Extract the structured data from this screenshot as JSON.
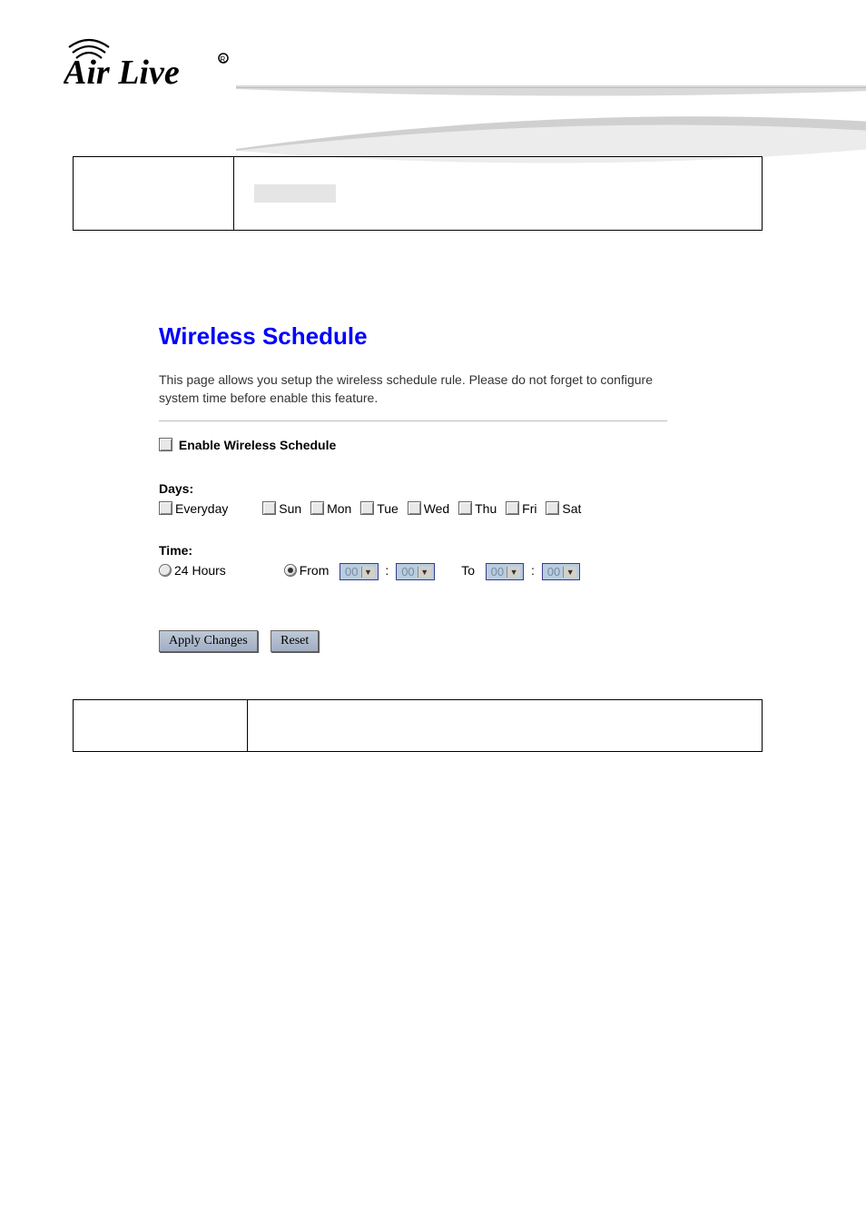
{
  "brand": {
    "name": "Air Live"
  },
  "screenshot": {
    "title": "Wireless Schedule",
    "description": "This page allows you setup the wireless schedule rule. Please do not forget to configure system time before enable this feature.",
    "enable_label": "Enable Wireless Schedule",
    "days_heading": "Days:",
    "everyday_label": "Everyday",
    "days": {
      "sun": "Sun",
      "mon": "Mon",
      "tue": "Tue",
      "wed": "Wed",
      "thu": "Thu",
      "fri": "Fri",
      "sat": "Sat"
    },
    "time_heading": "Time:",
    "hours24_label": "24 Hours",
    "from_label": "From",
    "to_label": "To",
    "sep": ":",
    "hh": "00",
    "mm": "00",
    "hh2": "00",
    "mm2": "00",
    "apply_label": "Apply Changes",
    "reset_label": "Reset"
  }
}
